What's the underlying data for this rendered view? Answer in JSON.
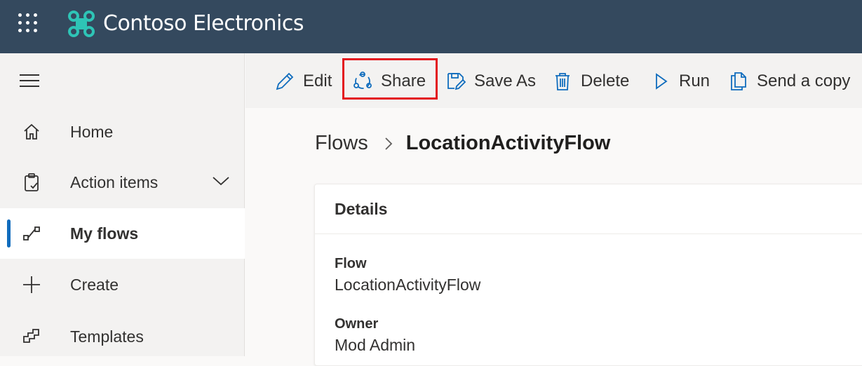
{
  "header": {
    "app_name": "Contoso Electronics",
    "background": "#34495e"
  },
  "sidebar": {
    "items": [
      {
        "label": "Home",
        "icon": "home-icon"
      },
      {
        "label": "Action items",
        "icon": "clipboard-check-icon"
      },
      {
        "label": "My flows",
        "icon": "flows-icon",
        "active": true
      },
      {
        "label": "Create",
        "icon": "plus-icon"
      },
      {
        "label": "Templates",
        "icon": "templates-icon"
      }
    ]
  },
  "toolbar": {
    "edit": "Edit",
    "share": "Share",
    "save_as": "Save As",
    "delete": "Delete",
    "run": "Run",
    "send_copy": "Send a copy",
    "accent": "#0f6cbd",
    "highlight": "#e3151e"
  },
  "breadcrumb": {
    "parent": "Flows",
    "current": "LocationActivityFlow"
  },
  "details": {
    "title": "Details",
    "flow_label": "Flow",
    "flow_value": "LocationActivityFlow",
    "owner_label": "Owner",
    "owner_value": "Mod Admin"
  }
}
